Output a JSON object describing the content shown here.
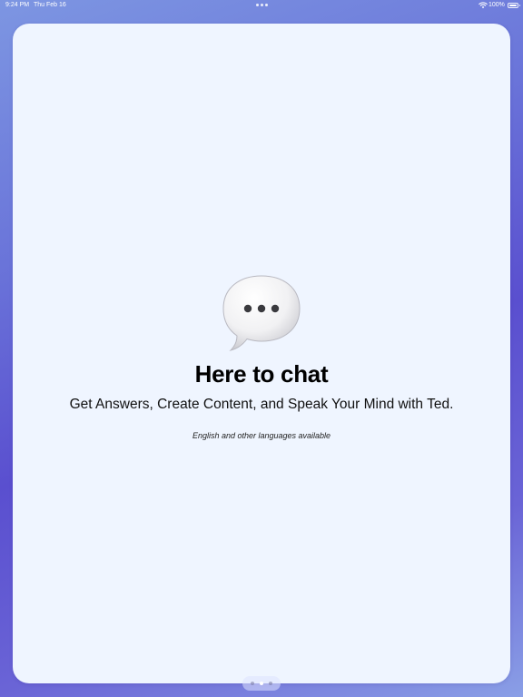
{
  "status_bar": {
    "time": "9:24 PM",
    "date": "Thu Feb 16",
    "battery_percent": "100%",
    "battery_level": 1.0,
    "icons": [
      "multitasking-dots-icon",
      "wifi-icon",
      "battery-icon"
    ]
  },
  "screen": {
    "icon": "speech-bubble-icon",
    "title": "Here to chat",
    "subtitle": "Get Answers, Create Content, and Speak Your Mind with Ted.",
    "note": "English and other languages available"
  },
  "pager": {
    "page_count": 3,
    "current_page": 2
  },
  "colors": {
    "card_background": "#eff5ff",
    "background_gradient_top": "#7d96e2",
    "background_gradient_mid": "#5a4fcf"
  }
}
